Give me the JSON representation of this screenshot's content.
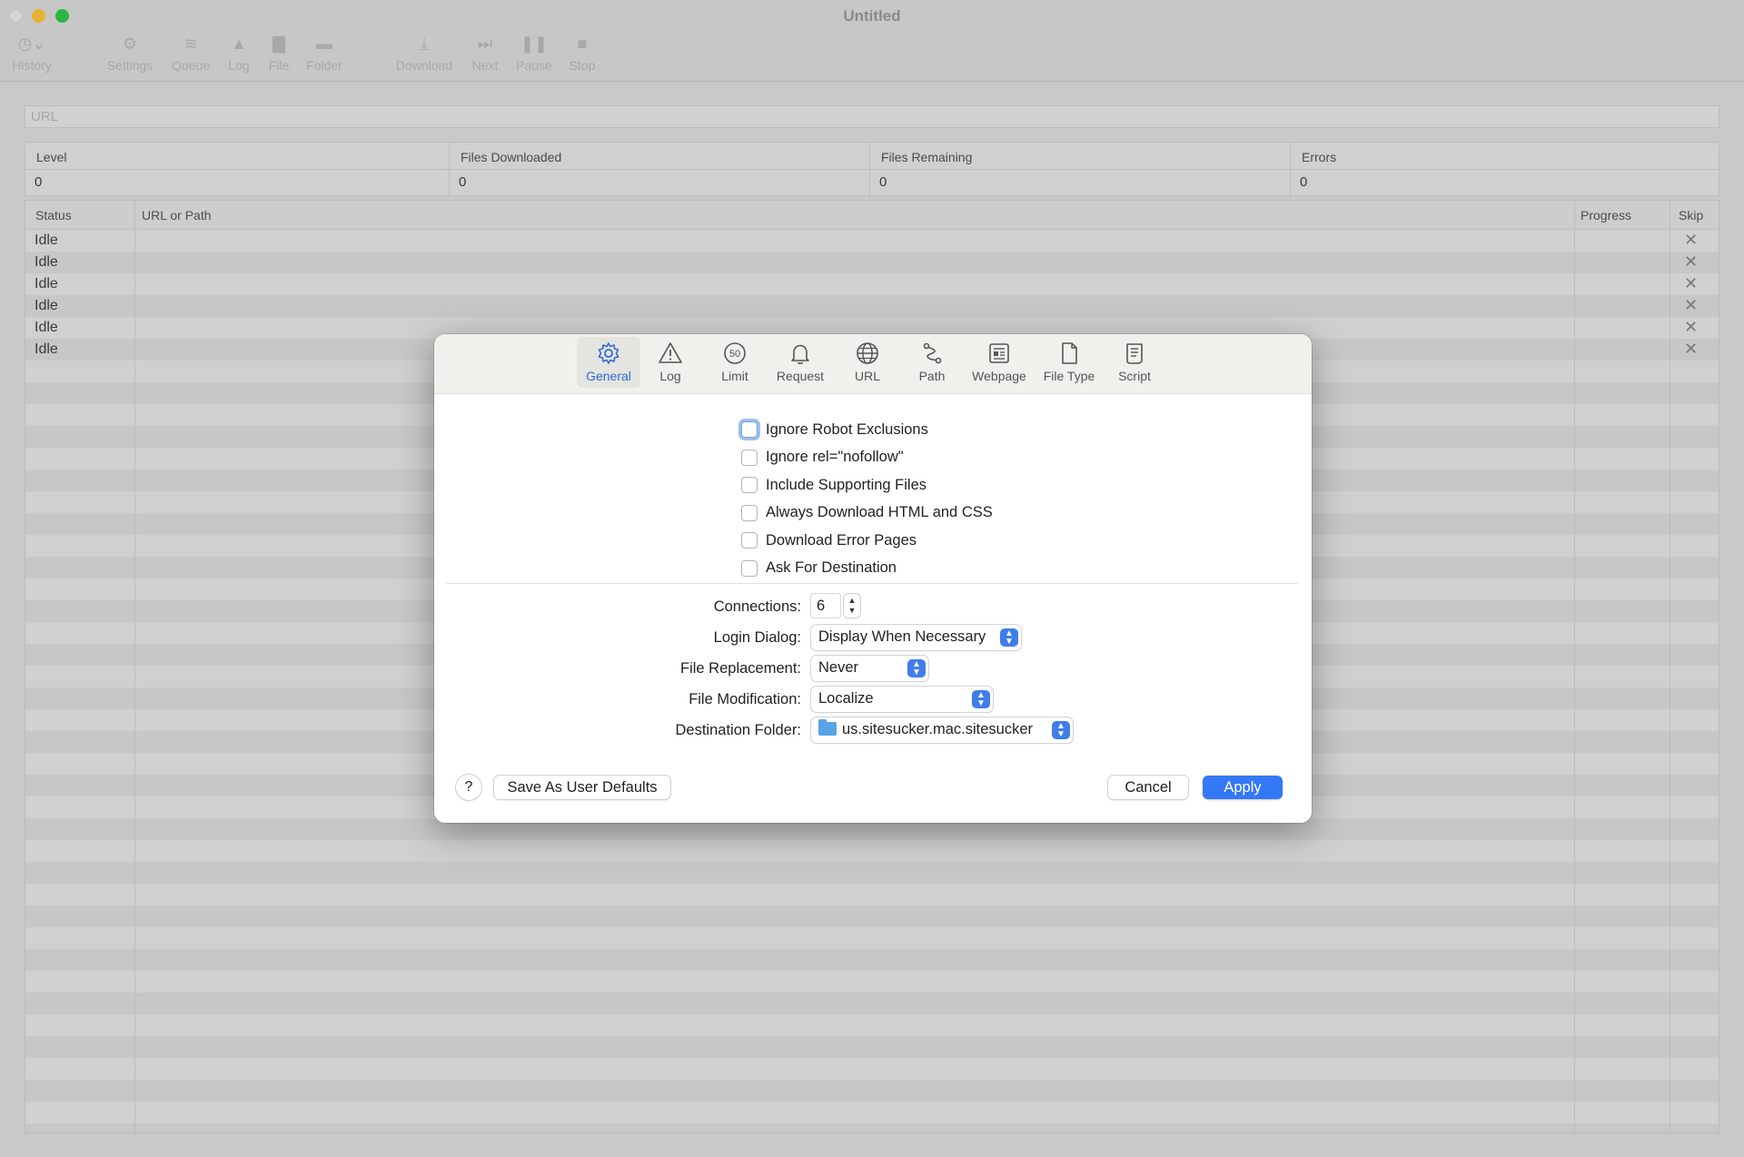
{
  "window": {
    "title": "Untitled"
  },
  "toolbar": {
    "items": [
      {
        "label": "History",
        "icon": "clock-icon"
      },
      {
        "label": "Settings",
        "icon": "gear-icon"
      },
      {
        "label": "Queue",
        "icon": "stack-icon"
      },
      {
        "label": "Log",
        "icon": "warning-icon"
      },
      {
        "label": "File",
        "icon": "document-icon"
      },
      {
        "label": "Folder",
        "icon": "folder-icon"
      },
      {
        "label": "Download",
        "icon": "download-icon"
      },
      {
        "label": "Next",
        "icon": "next-icon"
      },
      {
        "label": "Pause",
        "icon": "pause-icon"
      },
      {
        "label": "Stop",
        "icon": "stop-icon"
      }
    ]
  },
  "url_field": {
    "placeholder": "URL"
  },
  "stats": {
    "columns": [
      {
        "label": "Level",
        "value": "0"
      },
      {
        "label": "Files Downloaded",
        "value": "0"
      },
      {
        "label": "Files Remaining",
        "value": "0"
      },
      {
        "label": "Errors",
        "value": "0"
      }
    ]
  },
  "queue": {
    "headers": {
      "status": "Status",
      "url": "URL or Path",
      "progress": "Progress",
      "skip": "Skip"
    },
    "rows": [
      {
        "status": "Idle",
        "skip": "✕"
      },
      {
        "status": "Idle",
        "skip": "✕"
      },
      {
        "status": "Idle",
        "skip": "✕"
      },
      {
        "status": "Idle",
        "skip": "✕"
      },
      {
        "status": "Idle",
        "skip": "✕"
      },
      {
        "status": "Idle",
        "skip": "✕"
      }
    ]
  },
  "dialog": {
    "tabs": [
      {
        "label": "General",
        "icon": "gear-icon",
        "active": true
      },
      {
        "label": "Log",
        "icon": "warning-icon"
      },
      {
        "label": "Limit",
        "icon": "speed-limit-icon"
      },
      {
        "label": "Request",
        "icon": "bell-icon"
      },
      {
        "label": "URL",
        "icon": "globe-icon"
      },
      {
        "label": "Path",
        "icon": "path-icon"
      },
      {
        "label": "Webpage",
        "icon": "newspaper-icon"
      },
      {
        "label": "File Type",
        "icon": "document-icon"
      },
      {
        "label": "Script",
        "icon": "scroll-icon"
      }
    ],
    "limit_icon_text": "50",
    "checkboxes": [
      {
        "label": "Ignore Robot Exclusions",
        "checked": false
      },
      {
        "label": "Ignore rel=\"nofollow\"",
        "checked": false
      },
      {
        "label": "Include Supporting Files",
        "checked": false
      },
      {
        "label": "Always Download HTML and CSS",
        "checked": false
      },
      {
        "label": "Download Error Pages",
        "checked": false
      },
      {
        "label": "Ask For Destination",
        "checked": false
      }
    ],
    "connections": {
      "label": "Connections:",
      "value": "6"
    },
    "login_dialog": {
      "label": "Login Dialog:",
      "value": "Display When Necessary"
    },
    "file_replacement": {
      "label": "File Replacement:",
      "value": "Never"
    },
    "file_modification": {
      "label": "File Modification:",
      "value": "Localize"
    },
    "destination_folder": {
      "label": "Destination Folder:",
      "value": "us.sitesucker.mac.sitesucker"
    },
    "buttons": {
      "help": "?",
      "save_defaults": "Save As User Defaults",
      "cancel": "Cancel",
      "apply": "Apply"
    }
  },
  "colors": {
    "accent": "#3478f6",
    "active_tab": "#2f6bd3",
    "popup_arrow": "#3f7ee8"
  }
}
